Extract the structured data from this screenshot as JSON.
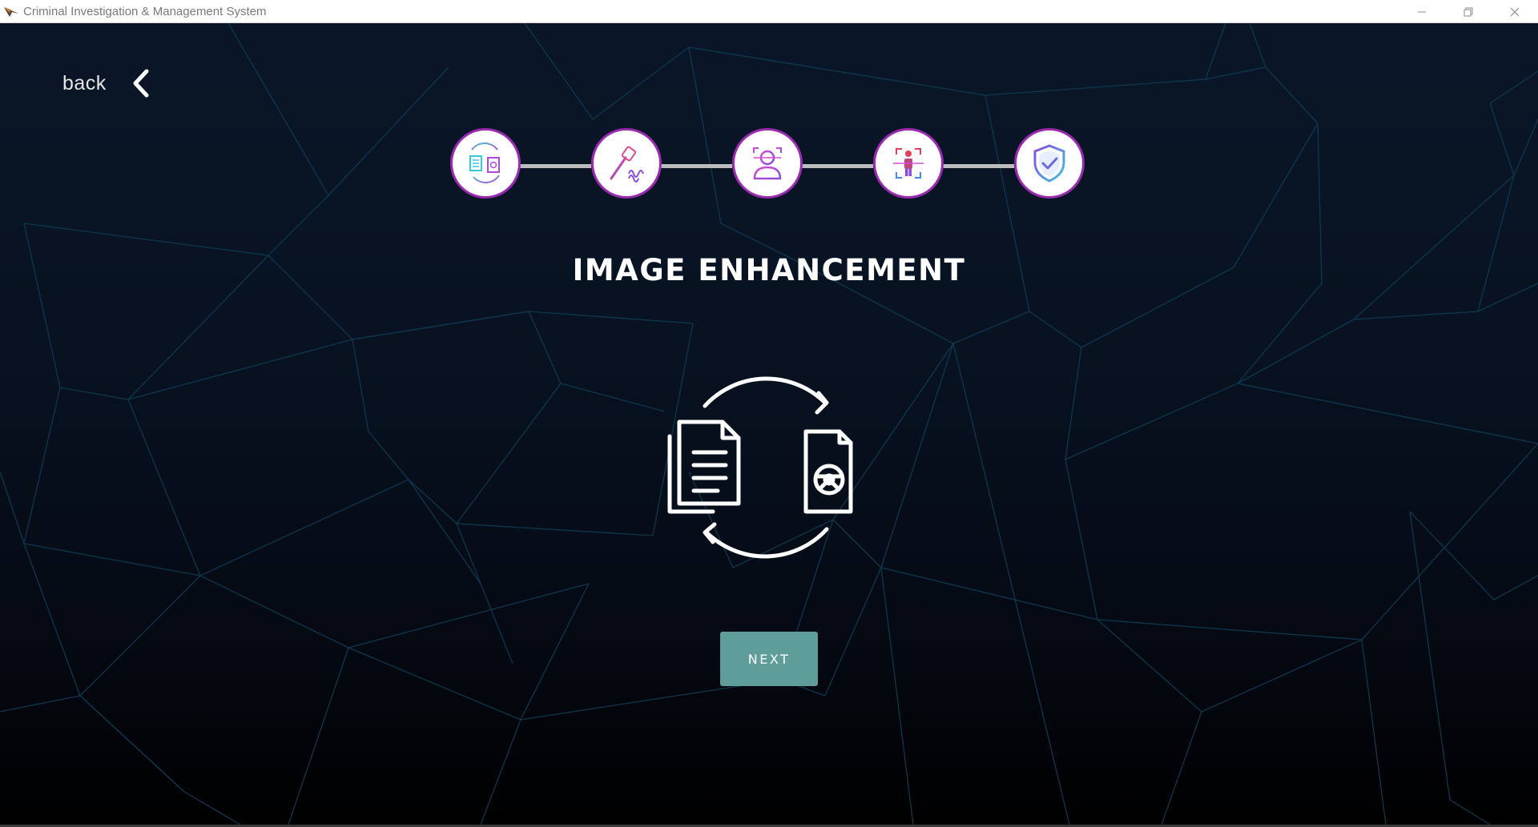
{
  "window": {
    "title": "Criminal Investigation & Management System",
    "controls": [
      "minimize-icon",
      "restore-icon",
      "close-icon"
    ]
  },
  "nav": {
    "back_label": "back",
    "back_icon": "chevron-left-icon"
  },
  "stepper": {
    "steps": [
      {
        "icon": "document-convert-icon",
        "active": true
      },
      {
        "icon": "fingerprint-tool-icon",
        "active": false
      },
      {
        "icon": "face-scan-icon",
        "active": false
      },
      {
        "icon": "body-scan-icon",
        "active": false
      },
      {
        "icon": "shield-check-icon",
        "active": false
      }
    ],
    "ring_color": "#9a2bb0",
    "line_color": "#bdbdbd"
  },
  "main": {
    "title": "IMAGE ENHANCEMENT",
    "hero_icon": "document-convert-icon",
    "next_label": "NEXT",
    "accent_color": "#5f9d9a"
  }
}
